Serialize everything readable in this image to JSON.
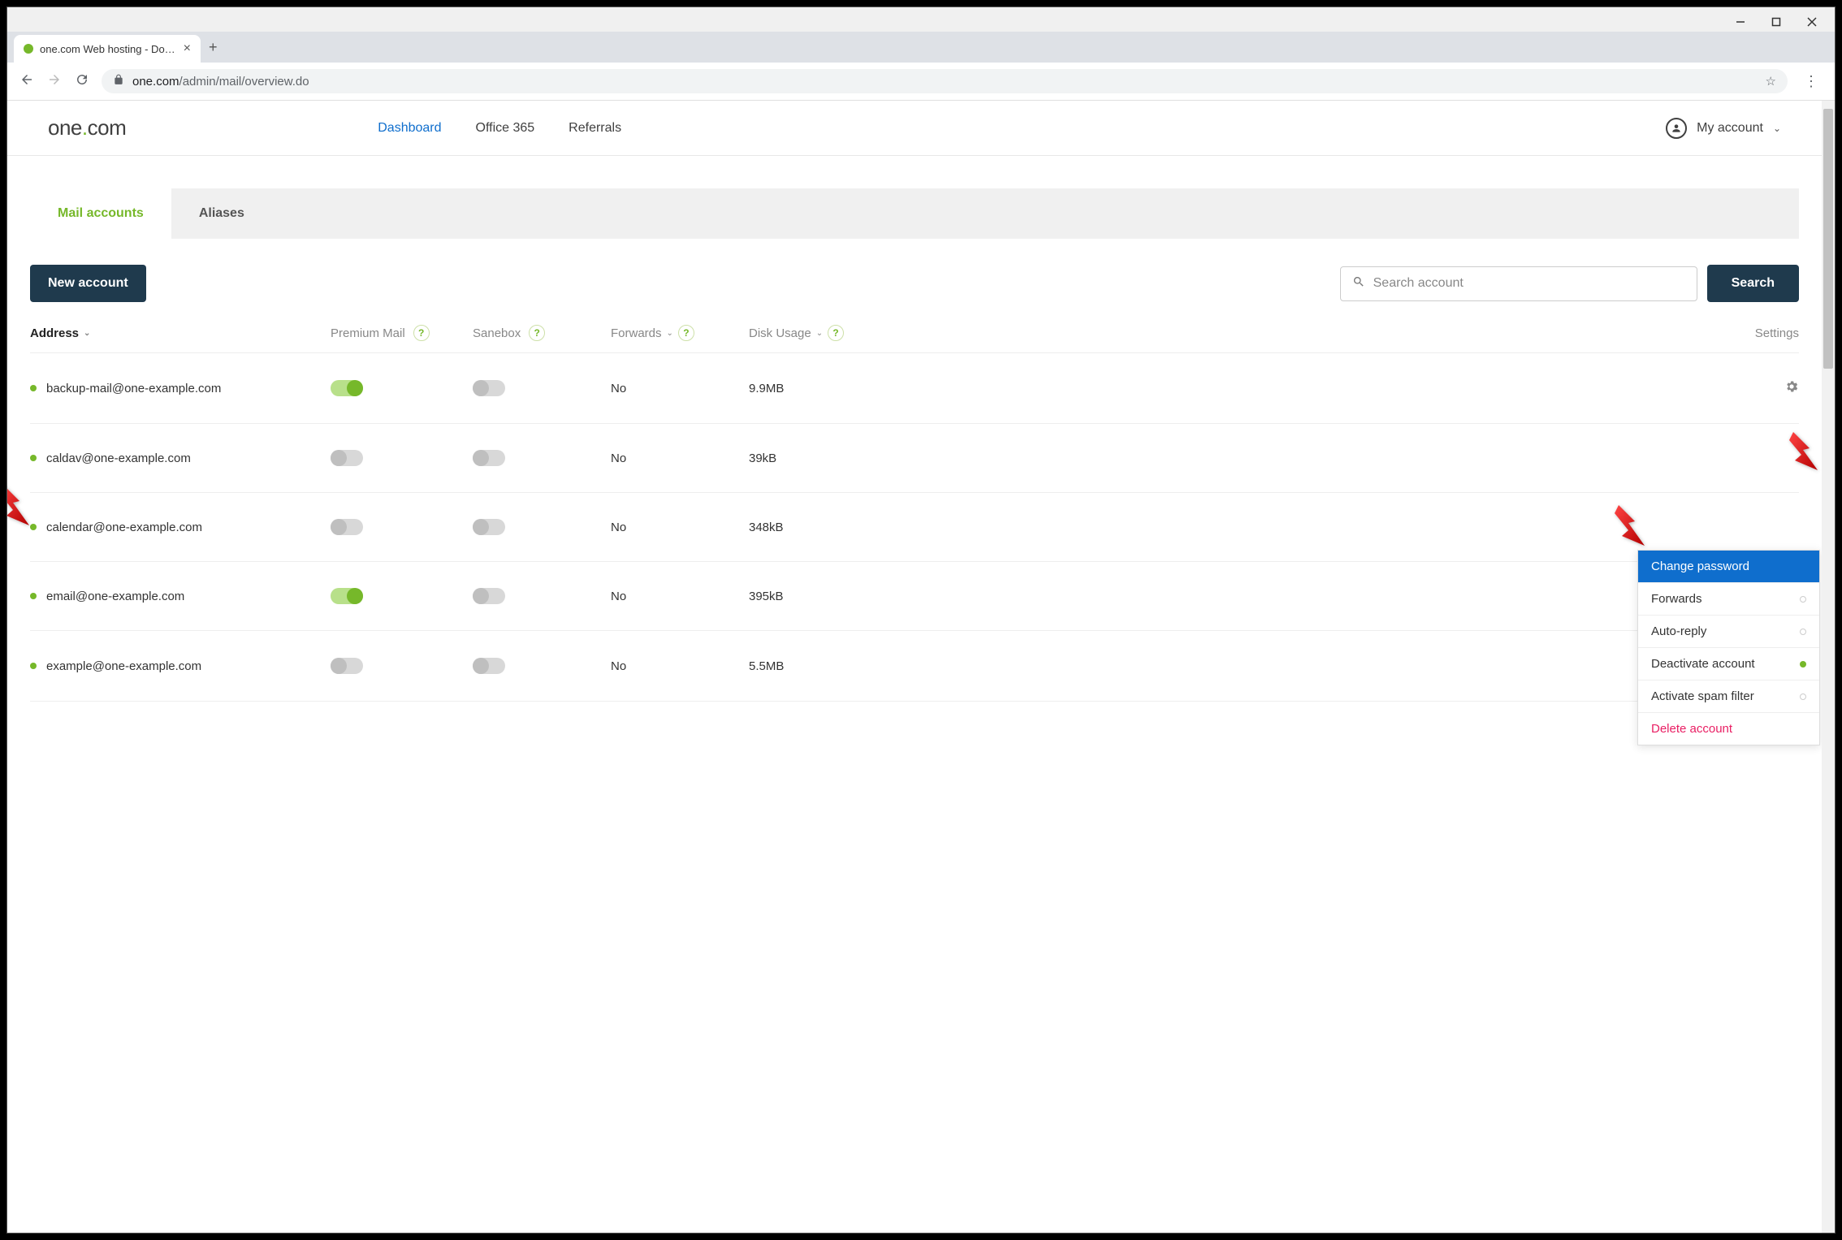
{
  "browser": {
    "tab_title": "one.com Web hosting  -  Domain",
    "url_domain": "one.com",
    "url_path": "/admin/mail/overview.do"
  },
  "header": {
    "logo_text_pre": "one",
    "logo_text_post": "com",
    "nav": {
      "dashboard": "Dashboard",
      "office365": "Office 365",
      "referrals": "Referrals"
    },
    "account_label": "My account"
  },
  "tabs": {
    "mail_accounts": "Mail accounts",
    "aliases": "Aliases"
  },
  "actions": {
    "new_account": "New account",
    "search_placeholder": "Search account",
    "search_button": "Search"
  },
  "columns": {
    "address": "Address",
    "premium": "Premium Mail",
    "sanebox": "Sanebox",
    "forwards": "Forwards",
    "disk": "Disk Usage",
    "settings": "Settings"
  },
  "rows": [
    {
      "address": "backup-mail@one-example.com",
      "premium_on": true,
      "sanebox_on": false,
      "forwards": "No",
      "disk": "9.9MB",
      "show_gear": true
    },
    {
      "address": "caldav@one-example.com",
      "premium_on": false,
      "sanebox_on": false,
      "forwards": "No",
      "disk": "39kB",
      "show_gear": false
    },
    {
      "address": "calendar@one-example.com",
      "premium_on": false,
      "sanebox_on": false,
      "forwards": "No",
      "disk": "348kB",
      "show_gear": false
    },
    {
      "address": "email@one-example.com",
      "premium_on": true,
      "sanebox_on": false,
      "forwards": "No",
      "disk": "395kB",
      "show_gear": false
    },
    {
      "address": "example@one-example.com",
      "premium_on": false,
      "sanebox_on": false,
      "forwards": "No",
      "disk": "5.5MB",
      "show_gear": true
    }
  ],
  "dropdown": {
    "change_password": "Change password",
    "forwards": "Forwards",
    "auto_reply": "Auto-reply",
    "deactivate": "Deactivate account",
    "spam_filter": "Activate spam filter",
    "delete": "Delete account"
  }
}
